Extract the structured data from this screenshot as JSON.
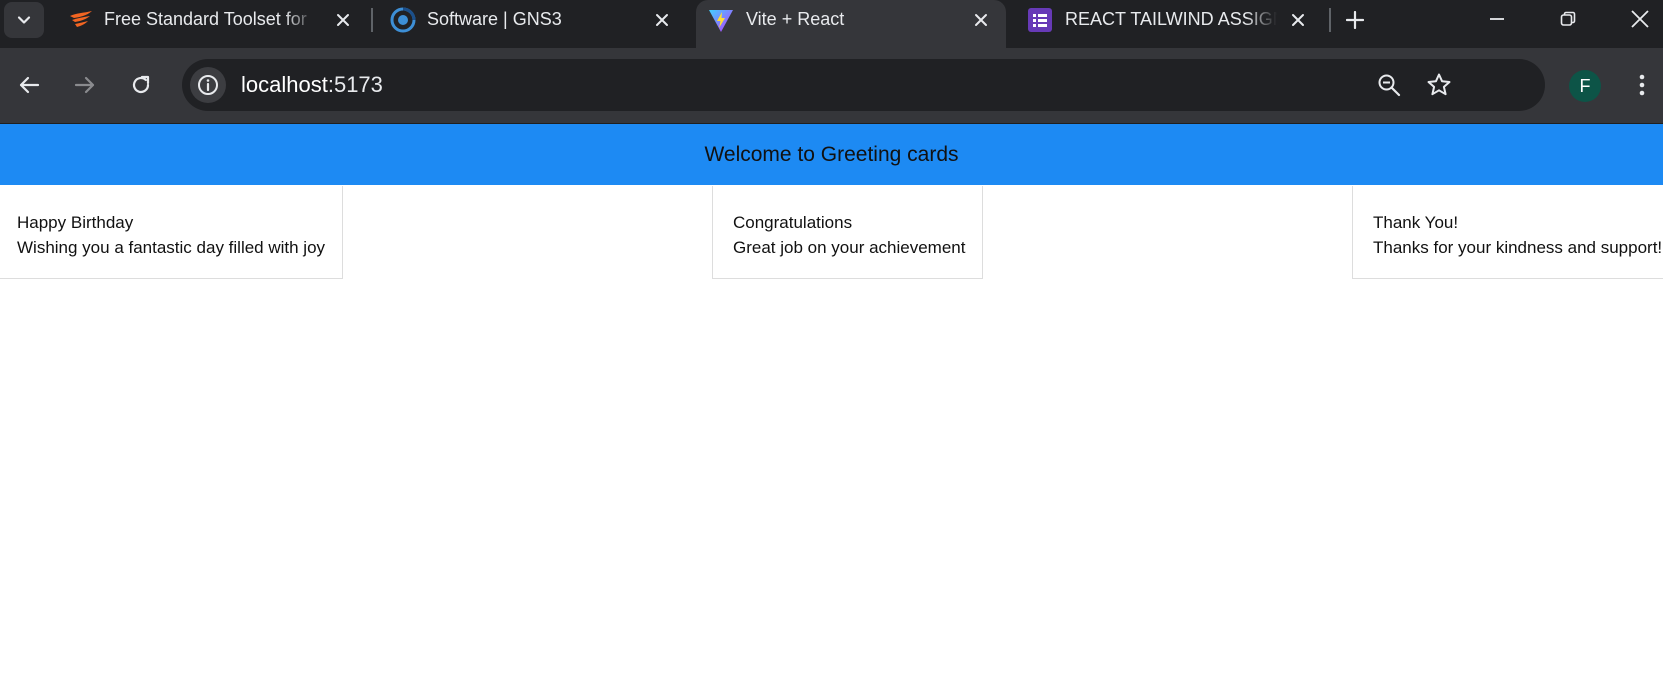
{
  "browser": {
    "tabs": [
      {
        "title": "Free Standard Toolset for",
        "favicon": "solarwinds-icon",
        "active": false
      },
      {
        "title": "Software | GNS3",
        "favicon": "gns3-icon",
        "active": false
      },
      {
        "title": "Vite + React",
        "favicon": "vite-icon",
        "active": true
      },
      {
        "title": "REACT TAILWIND ASSIGN",
        "favicon": "forms-icon",
        "active": false
      }
    ],
    "address_bar": {
      "host": "localhost",
      "port": ":5173"
    },
    "profile_initial": "F",
    "colors": {
      "tabstrip": "#202124",
      "toolbar": "#35363a",
      "omnibox": "#202124",
      "avatar": "#0d5447"
    }
  },
  "page": {
    "banner_title": "Welcome to Greeting cards",
    "banner_color": "#1d8af3",
    "cards": [
      {
        "heading": "Happy Birthday",
        "message": "Wishing you a fantastic day filled with joy"
      },
      {
        "heading": "Congratulations",
        "message": "Great job on your achievement"
      },
      {
        "heading": "Thank You!",
        "message": "Thanks for your kindness and support!"
      }
    ]
  }
}
